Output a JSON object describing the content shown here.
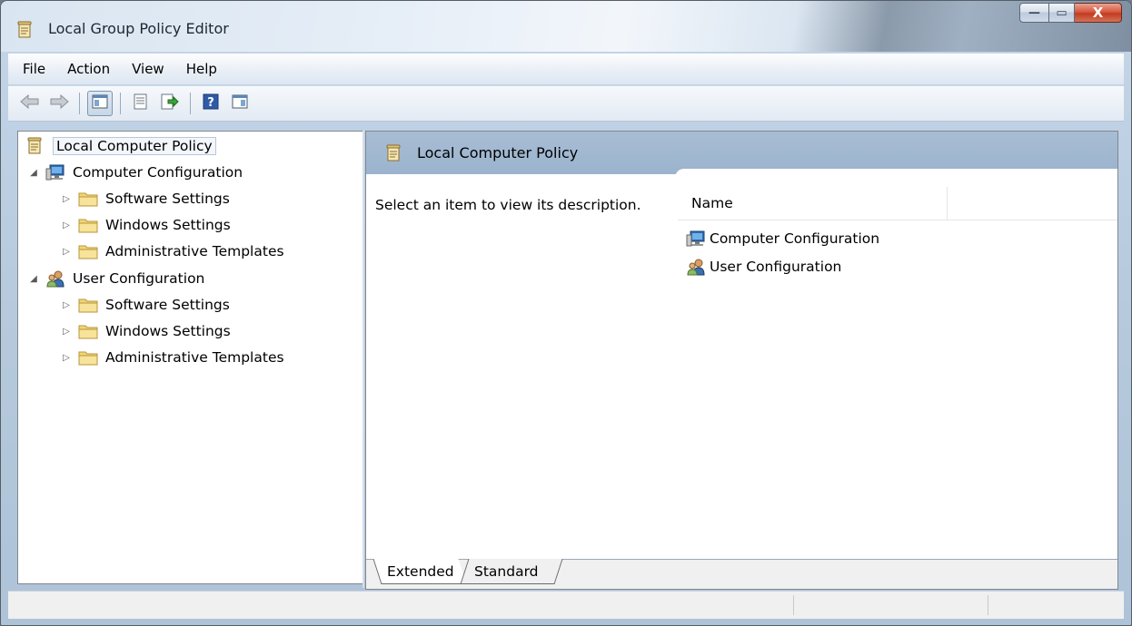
{
  "window": {
    "title": "Local Group Policy Editor",
    "minimize_glyph": "—",
    "maximize_glyph": "▭",
    "close_glyph": "X"
  },
  "menu": [
    "File",
    "Action",
    "View",
    "Help"
  ],
  "toolbar": {
    "buttons": [
      "back-icon",
      "forward-icon",
      "show-hide-console-tree-icon",
      "properties-icon",
      "export-list-icon",
      "help-icon",
      "show-hide-action-pane-icon"
    ]
  },
  "tree": {
    "root": "Local Computer Policy",
    "computer": {
      "label": "Computer Configuration",
      "children": [
        "Software Settings",
        "Windows Settings",
        "Administrative Templates"
      ]
    },
    "user": {
      "label": "User Configuration",
      "children": [
        "Software Settings",
        "Windows Settings",
        "Administrative Templates"
      ]
    }
  },
  "details": {
    "header_title": "Local Computer Policy",
    "description": "Select an item to view its description.",
    "column_name": "Name",
    "items": [
      "Computer Configuration",
      "User Configuration"
    ]
  },
  "tabs": {
    "extended": "Extended",
    "standard": "Standard",
    "active": "Extended"
  },
  "colors": {
    "header_bg": "#9bb3cd",
    "folder_yellow": "#f2d675",
    "accent_blue": "#2f6fb6"
  }
}
